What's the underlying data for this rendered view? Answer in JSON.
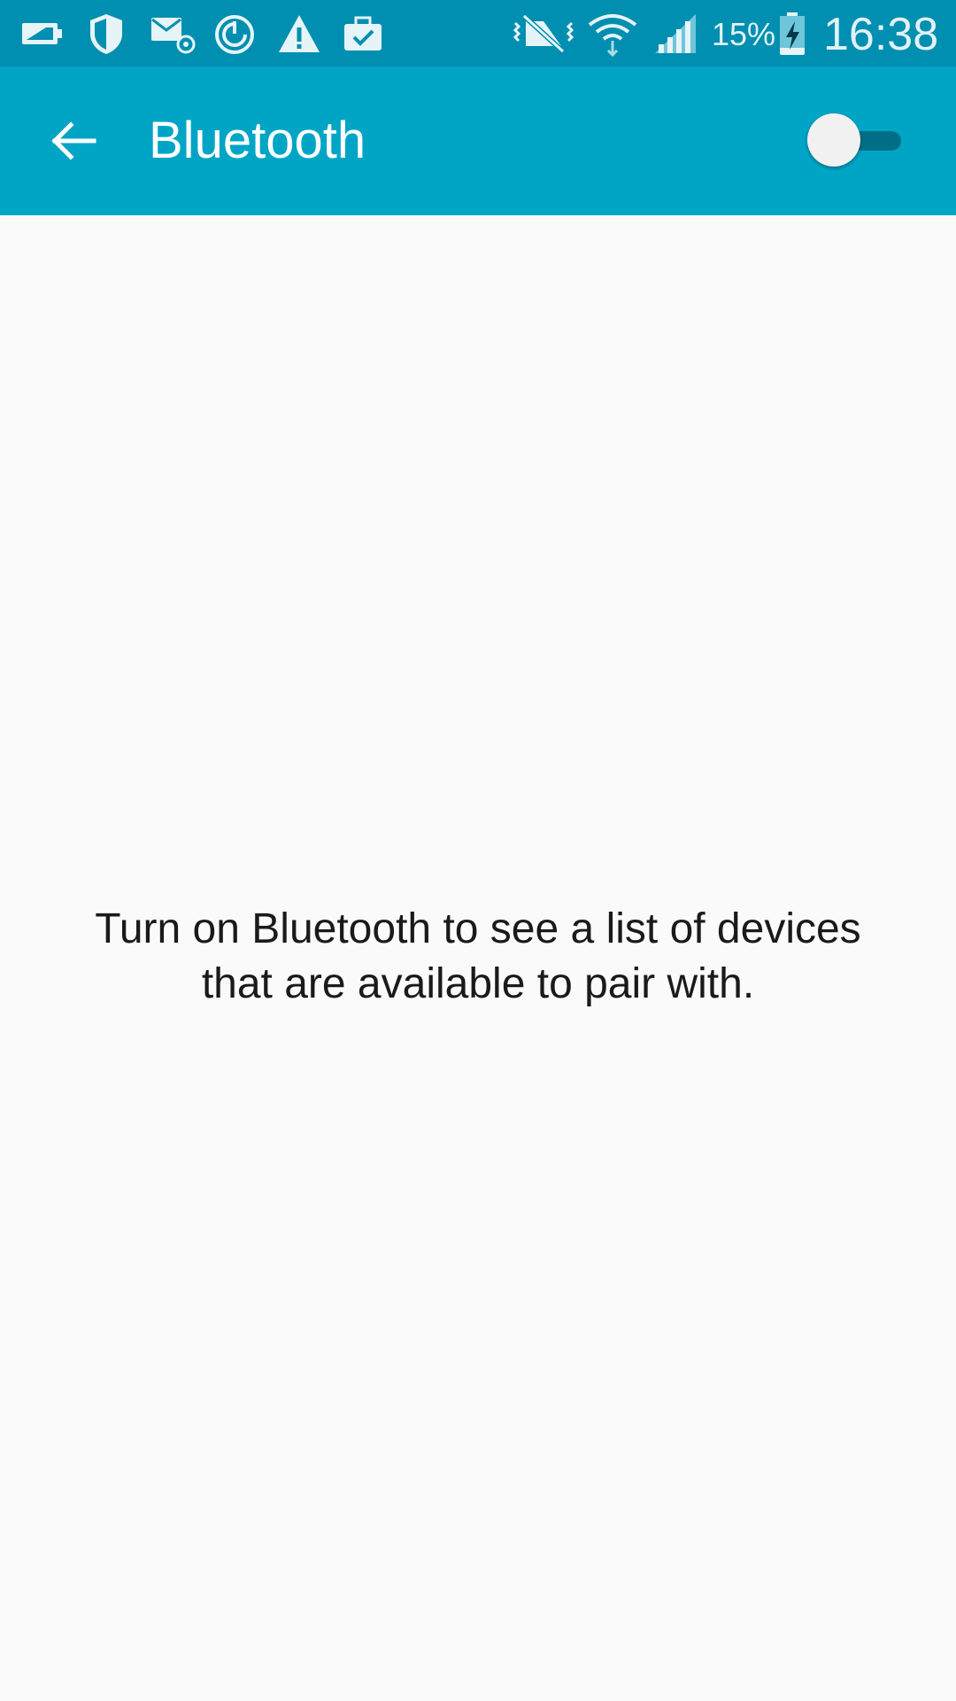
{
  "status_bar": {
    "left_icons": [
      "battery-saver-icon",
      "shield-icon",
      "email-at-icon",
      "power-sync-icon",
      "warning-icon",
      "briefcase-check-icon"
    ],
    "right_icons": [
      "vibrate-mute-icon",
      "wifi-icon",
      "signal-icon",
      "battery-charging-icon"
    ],
    "battery_percent": "15%",
    "time": "16:38"
  },
  "app_bar": {
    "title": "Bluetooth",
    "back_icon": "arrow-back-icon",
    "toggle_state": "off"
  },
  "main": {
    "message_line1": "Turn on Bluetooth to see a list of devices",
    "message_line2": "that are available to pair with."
  },
  "colors": {
    "status_bar": "#008fb0",
    "app_bar": "#00a5c6",
    "background": "#fafafa",
    "toggle_track": "#006f86"
  }
}
